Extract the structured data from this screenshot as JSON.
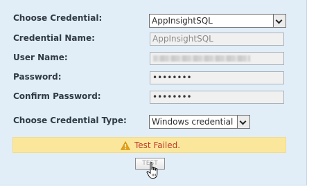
{
  "form": {
    "choose_credential": {
      "label": "Choose Credential:",
      "selected": "AppInsightSQL"
    },
    "credential_name": {
      "label": "Credential Name:",
      "value": "AppInsightSQL"
    },
    "user_name": {
      "label": "User Name:",
      "value": ""
    },
    "password": {
      "label": "Password:",
      "value": "••••••••"
    },
    "confirm_password": {
      "label": "Confirm Password:",
      "value": "••••••••"
    },
    "credential_type": {
      "label": "Choose Credential Type:",
      "selected": "Windows credential"
    }
  },
  "status": {
    "icon": "warning-icon",
    "message": "Test Failed.",
    "text_color": "#c0392b",
    "background": "#fbe79c"
  },
  "actions": {
    "test_label": "TEST"
  },
  "colors": {
    "panel_background": "#e1edf7"
  }
}
